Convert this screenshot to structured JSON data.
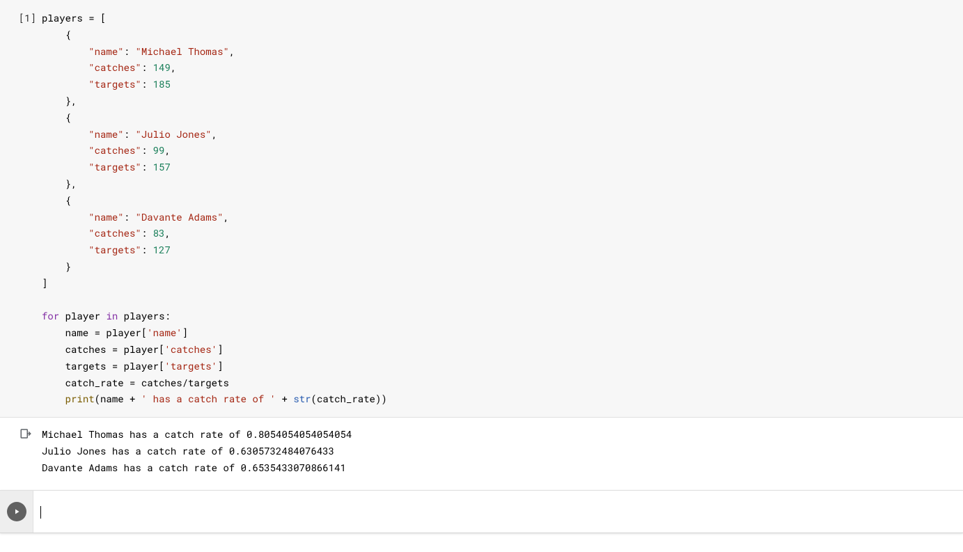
{
  "cell": {
    "prompt": "[1]",
    "players": [
      {
        "name": "Michael Thomas",
        "catches": 149,
        "targets": 185
      },
      {
        "name": "Julio Jones",
        "catches": 99,
        "targets": 157
      },
      {
        "name": "Davante Adams",
        "catches": 83,
        "targets": 127
      }
    ],
    "code_text": {
      "players_var": "players",
      "eq": " = [",
      "open_brace": "    {",
      "key_name": "\"name\"",
      "key_catches": "\"catches\"",
      "key_targets": "\"targets\"",
      "colon_sp": ": ",
      "comma": ",",
      "close_brace_comma": "    },",
      "close_brace": "    }",
      "close_list": "]",
      "blank": "",
      "for": "for",
      "in": "in",
      "player": "player",
      "players_colon": "players:",
      "line_name": "    name = player[",
      "line_catches": "    catches = player[",
      "line_targets": "    targets = player[",
      "str_name": "'name'",
      "str_catches": "'catches'",
      "str_targets": "'targets'",
      "brk_close": "]",
      "catch_rate": "    catch_rate = catches/targets",
      "print": "print",
      "print_open": "(",
      "name_var": "name",
      "plus": " + ",
      "lit1": "' has a catch rate of '",
      "str_builtin": "str",
      "str_open": "(",
      "cr_var": "catch_rate",
      "close2": "))",
      "indent_print": "    "
    }
  },
  "output": {
    "lines": [
      "Michael Thomas has a catch rate of 0.8054054054054054",
      "Julio Jones has a catch rate of 0.6305732484076433",
      "Davante Adams has a catch rate of 0.6535433070866141"
    ]
  },
  "icons": {
    "output": "output-icon",
    "play": "play-icon"
  }
}
